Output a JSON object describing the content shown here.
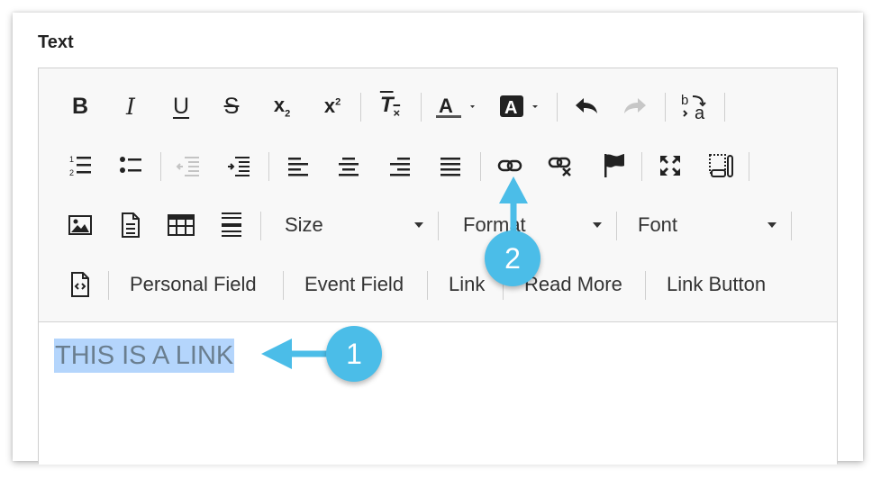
{
  "field": {
    "label": "Text"
  },
  "toolbar": {
    "format": {
      "size": "Size",
      "format": "Format",
      "font": "Font"
    },
    "insert_buttons": {
      "personal_field": "Personal Field",
      "event_field": "Event Field",
      "link": "Link",
      "read_more": "Read More",
      "link_button": "Link Button"
    }
  },
  "editor": {
    "content": "THIS IS A LINK"
  },
  "annotations": {
    "step1": "1",
    "step2": "2"
  },
  "colors": {
    "callout": "#4bbde8",
    "selection": "#b4d5fc"
  }
}
